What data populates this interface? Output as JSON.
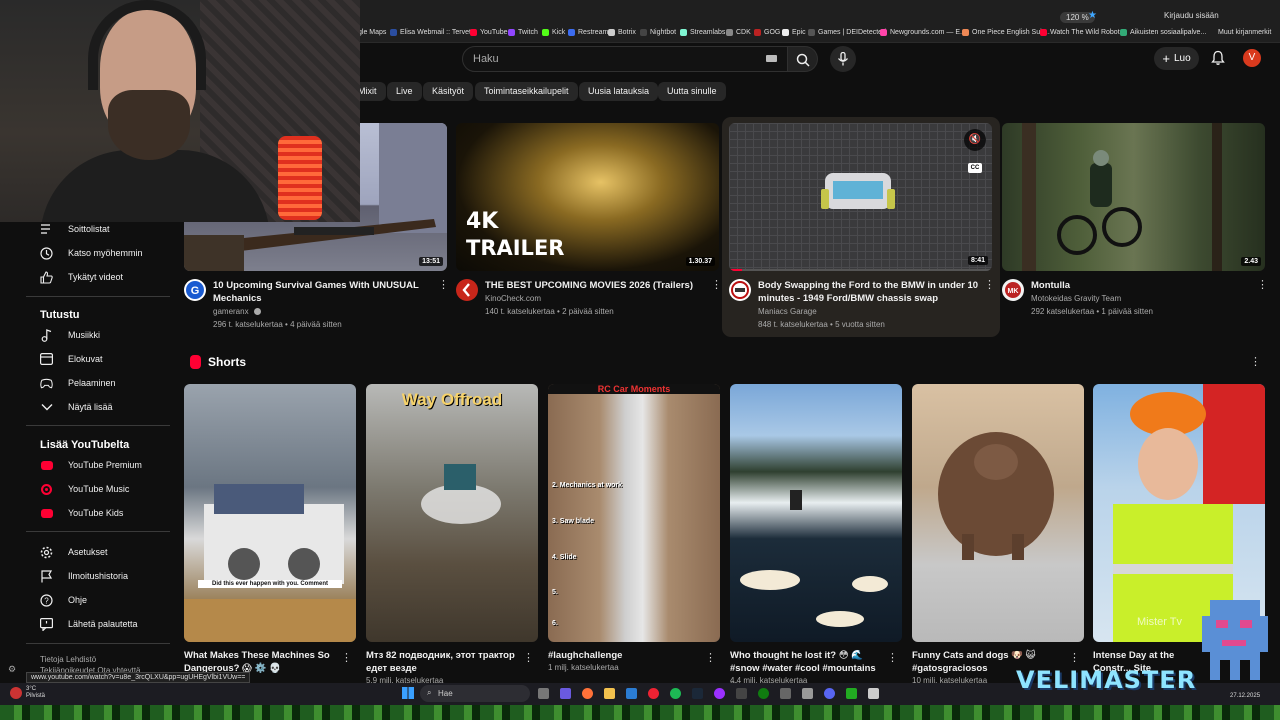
{
  "browser": {
    "zoom": "120 %",
    "login": "Kirjaudu sisään",
    "bookmarks": [
      "gle Maps",
      "Elisa Webmail :: Tervet...",
      "YouTube",
      "Twitch",
      "Kick",
      "Restream",
      "Botrix",
      "Nightbot",
      "Streamlabs",
      "CDK",
      "GOG",
      "Epic",
      "Games | DEIDetected",
      "Newgrounds.com — E...",
      "One Piece English Sub...",
      "Watch The Wild Robot...",
      "Aikuisten sosiaalipalve..."
    ],
    "bookmarks_more": "Muut kirjanmerkit"
  },
  "header": {
    "search_placeholder": "Haku",
    "create_label": "Luo",
    "avatar_letter": "V"
  },
  "chips": [
    "Mixit",
    "Live",
    "Käsityöt",
    "Toimintaseikkailupelit",
    "Uusia latauksia",
    "Uutta sinulle"
  ],
  "sidebar": {
    "you_items": [
      "Soittolistat",
      "Katso myöhemmin",
      "Tykätyt videot"
    ],
    "explore_heading": "Tutustu",
    "explore_items": [
      "Musiikki",
      "Elokuvat",
      "Pelaaminen",
      "Näytä lisää"
    ],
    "more_heading": "Lisää YouTubelta",
    "more_items": [
      "YouTube Premium",
      "YouTube Music",
      "YouTube Kids"
    ],
    "settings_items": [
      "Asetukset",
      "Ilmoitushistoria",
      "Ohje",
      "Lähetä palautetta"
    ],
    "footer_line1": "Tietoja   Lehdistö",
    "footer_line2": "Tekijänoikeudet   Ota yhteyttä"
  },
  "videos": [
    {
      "title": "10 Upcoming Survival Games With UNUSUAL Mechanics",
      "channel": "gameranx",
      "meta": "296 t. katselukertaa • 4 päivää sitten",
      "duration": "13:51"
    },
    {
      "title": "THE BEST UPCOMING MOVIES 2026 (Trailers)",
      "channel": "KinoCheck.com",
      "meta": "140 t. katselukertaa • 2 päivää sitten",
      "duration": "1.30.37",
      "thumb_text_top": "4K",
      "thumb_text_bottom": "TRAILER"
    },
    {
      "title": "Body Swapping the Ford to the BMW in under 10 minutes - 1949 Ford/BMW chassis swap",
      "channel": "Maniacs Garage",
      "meta": "848 t. katselukertaa • 5 vuotta sitten",
      "duration": "8:41"
    },
    {
      "title": "Montulla",
      "channel": "Motokeidas Gravity Team",
      "meta": "292 katselukertaa • 1 päivää sitten",
      "duration": "2.43"
    }
  ],
  "shorts_heading": "Shorts",
  "shorts": [
    {
      "title": "What Makes These Machines So Dangerous? 😱 ⚙️ 💀",
      "meta": "",
      "overlay": "Did this ever happen with you. Comment"
    },
    {
      "title": "Мтз 82 подводник, этот трактор едет везде",
      "meta": "5,9 milj. katselukertaa",
      "overlay": "Way Offroad"
    },
    {
      "title": "#laughchallenge",
      "meta": "1 milj. katselukertaa",
      "overlay": "RC Car Moments",
      "labels": [
        "2. Mechanics at work",
        "3. Saw blade",
        "4. Slide",
        "5.",
        "6."
      ]
    },
    {
      "title": "Who thought he lost it? 😳 🌊 #snow #water #cool #mountains ...",
      "meta": "4,4 milj. katselukertaa",
      "overlay": ""
    },
    {
      "title": "Funny Cats and dogs 🐶 😺 #gatosgraciosos",
      "meta": "10 milj. katselukertaa",
      "overlay": ""
    },
    {
      "title": "Intense Day at the Constr... Site",
      "meta": "",
      "overlay": "Mister Tv"
    }
  ],
  "status_url": "www.youtube.com/watch?v=u8e_3rcQLXU&pp=ugUHEgVlbi1VUw==",
  "taskbar": {
    "weather_temp": "3°C",
    "weather_text": "Pilvistä",
    "search": "Hae",
    "date": "27.12.2025"
  },
  "overlay_logo": "VELIMASTER",
  "colors": {
    "accent_red": "#ff0033",
    "background": "#0f0f0f",
    "chip": "#272727",
    "avatar": "#d93a1e"
  }
}
